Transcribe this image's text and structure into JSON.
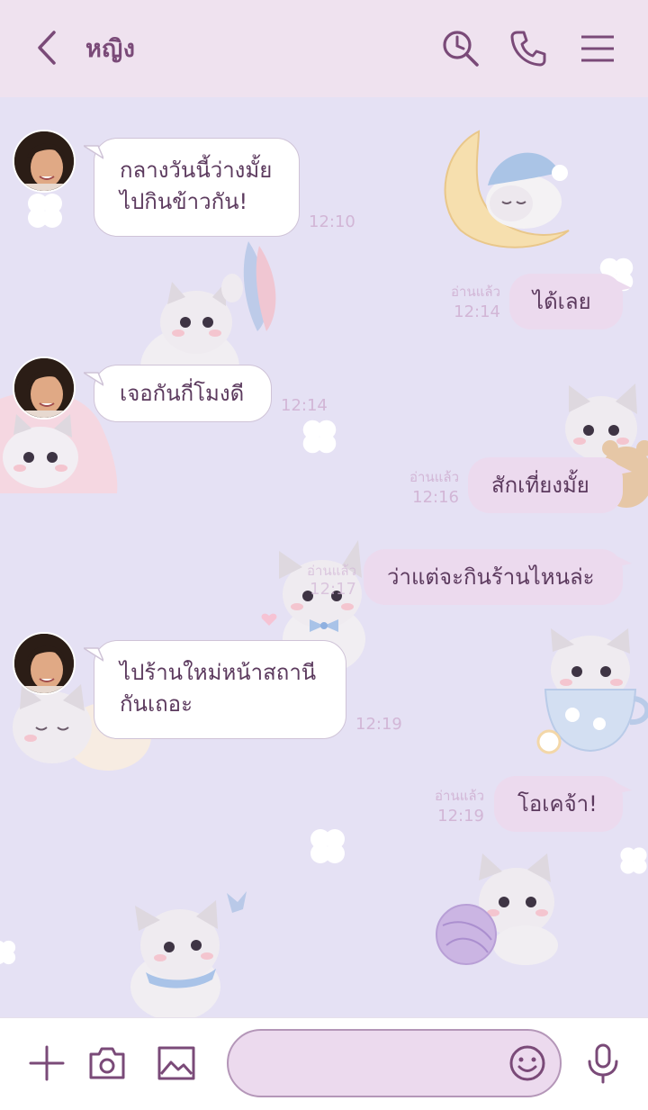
{
  "header": {
    "title": "หญิง",
    "icons": [
      "back-icon",
      "search-history-icon",
      "phone-icon",
      "menu-icon"
    ]
  },
  "messages": [
    {
      "side": "in",
      "lines": [
        "กลางวันนี้ว่างมั้ย",
        "ไปกินข้าวกัน!"
      ],
      "time": "12:10"
    },
    {
      "side": "out",
      "text": "ได้เลย",
      "read": "อ่านแล้ว",
      "time": "12:14"
    },
    {
      "side": "in",
      "lines": [
        "เจอกันกี่โมงดี"
      ],
      "time": "12:14"
    },
    {
      "side": "out",
      "text": "สักเที่ยงมั้ย",
      "read": "อ่านแล้ว",
      "time": "12:16"
    },
    {
      "side": "out",
      "text": "ว่าแต่จะกินร้านไหนล่ะ",
      "read": "อ่านแล้ว",
      "time": "12:17"
    },
    {
      "side": "in",
      "lines": [
        "ไปร้านใหม่หน้าสถานี",
        "กันเถอะ"
      ],
      "time": "12:19"
    },
    {
      "side": "out",
      "text": "โอเคจ้า!",
      "read": "อ่านแล้ว",
      "time": "12:19"
    }
  ],
  "footer": {
    "icons": [
      "plus-icon",
      "camera-icon",
      "image-icon",
      "emoji-icon",
      "microphone-icon"
    ],
    "input_value": ""
  },
  "colors": {
    "background": "#e5e1f4",
    "header": "#efe2ef",
    "accent": "#7a4a78",
    "outgoing_bubble": "#ecdaee",
    "timestamp": "#d2b6d6"
  }
}
